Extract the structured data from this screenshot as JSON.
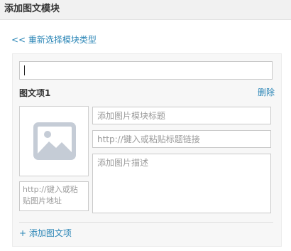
{
  "header": {
    "title": "添加图文模块"
  },
  "back_link": "<< 重新选择模块类型",
  "module": {
    "title_input_value": ""
  },
  "item": {
    "label": "图文项1",
    "delete_label": "删除",
    "image_url_placeholder": "http://键入或粘贴图片地址",
    "title_placeholder": "添加图片模块标题",
    "link_placeholder": "http://键入或粘贴标题链接",
    "desc_placeholder": "添加图片描述"
  },
  "add_item_label": "+ 添加图文项",
  "icons": {
    "image_placeholder": "image-placeholder-icon"
  },
  "colors": {
    "link": "#2a85b6",
    "header_bg": "#f1f1f1",
    "panel_bg": "#f7f7f7"
  }
}
